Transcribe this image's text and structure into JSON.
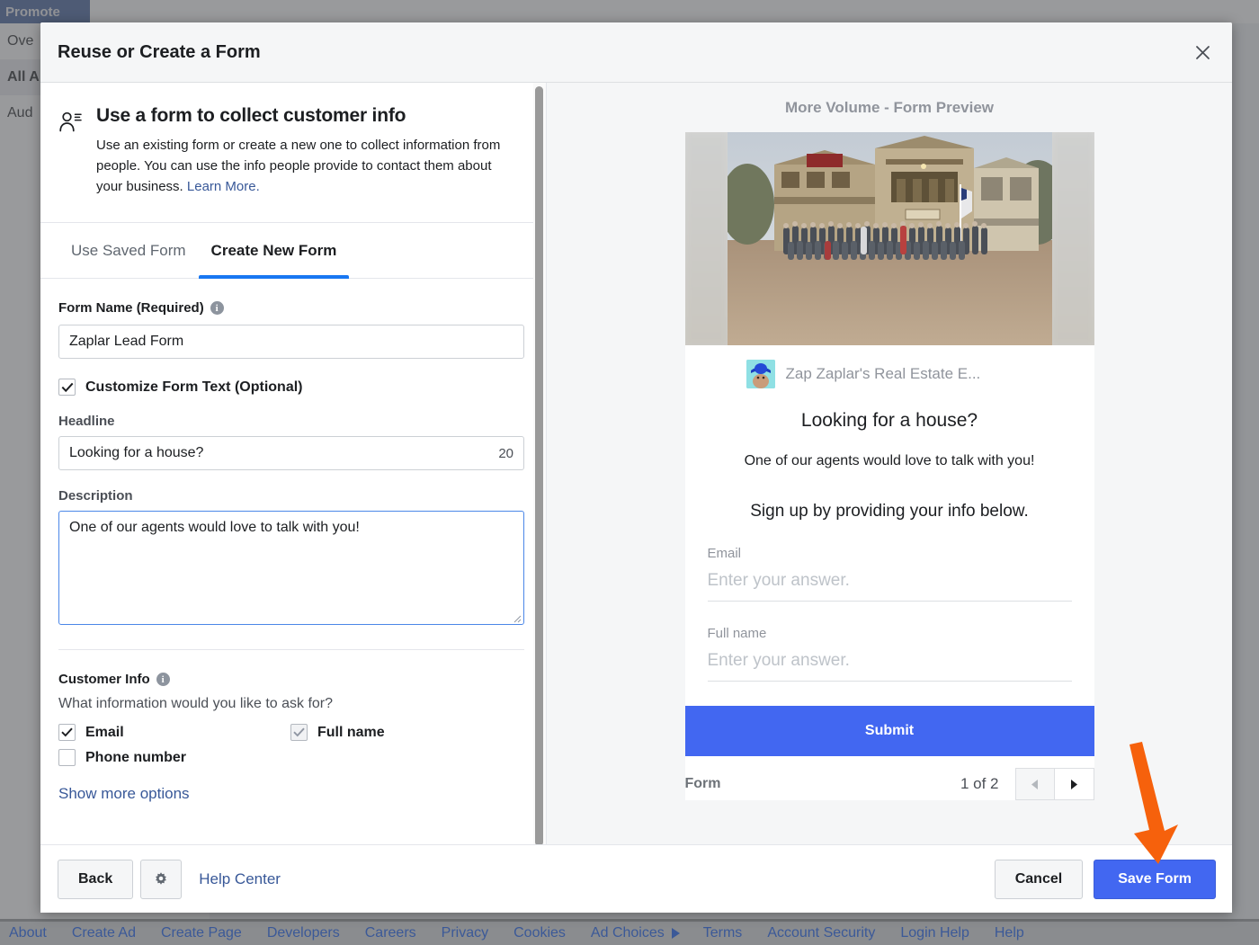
{
  "background": {
    "top_tab": "Promote",
    "nav_items": [
      {
        "label": "Ove",
        "selected": false
      },
      {
        "label": "All A",
        "selected": true
      },
      {
        "label": "Aud",
        "selected": false
      }
    ]
  },
  "footer_links": [
    "About",
    "Create Ad",
    "Create Page",
    "Developers",
    "Careers",
    "Privacy",
    "Cookies",
    "Ad Choices",
    "Terms",
    "Account Security",
    "Login Help",
    "Help"
  ],
  "modal": {
    "title": "Reuse or Create a Form",
    "close_icon": "close-icon",
    "intro": {
      "icon": "person-list-icon",
      "heading": "Use a form to collect customer info",
      "body": "Use an existing form or create a new one to collect information from people. You can use the info people provide to contact them about your business.",
      "link_label": "Learn More."
    },
    "tabs": [
      {
        "label": "Use Saved Form",
        "active": false
      },
      {
        "label": "Create New Form",
        "active": true
      }
    ],
    "form": {
      "form_name_label": "Form Name (Required)",
      "form_name_info_icon": "info-icon",
      "form_name_value": "Zaplar Lead Form",
      "customize_checkbox_label": "Customize Form Text (Optional)",
      "customize_checked": true,
      "headline_label": "Headline",
      "headline_value": "Looking for a house?",
      "headline_counter": "20",
      "description_label": "Description",
      "description_value": "One of our agents would love to talk with you!",
      "customer_info_label": "Customer Info",
      "customer_info_icon": "info-icon",
      "customer_info_question": "What information would you like to ask for?",
      "customer_info_options": [
        {
          "label": "Email",
          "checked": true,
          "disabled": false
        },
        {
          "label": "Full name",
          "checked": true,
          "disabled": true
        },
        {
          "label": "Phone number",
          "checked": false,
          "disabled": false
        }
      ],
      "show_more_label": "Show more options"
    },
    "preview": {
      "title": "More Volume - Form Preview",
      "hero_image_alt": "group-photo-western-town",
      "avatar_alt": "page-avatar",
      "business_name": "Zap Zaplar's Real Estate E...",
      "headline": "Looking for a house?",
      "description": "One of our agents would love to talk with you!",
      "signup_text": "Sign up by providing your info below.",
      "fields": [
        {
          "label": "Email",
          "placeholder": "Enter your answer."
        },
        {
          "label": "Full name",
          "placeholder": "Enter your answer."
        }
      ],
      "submit_label": "Submit",
      "pager_label": "Form",
      "pager_count": "1 of 2",
      "prev_icon": "chevron-left-icon",
      "next_icon": "chevron-right-icon"
    },
    "footer": {
      "back_label": "Back",
      "settings_icon": "gear-icon",
      "help_center_label": "Help Center",
      "cancel_label": "Cancel",
      "save_label": "Save Form"
    }
  },
  "annotation": {
    "arrow_icon": "down-arrow-annotation",
    "arrow_color": "#F6610C",
    "points_to": "Save Form"
  },
  "colors": {
    "primary_blue": "#4267f1",
    "tab_underline": "#1877f2",
    "link_blue": "#385898",
    "brand_navy": "#3b5998",
    "annotation_orange": "#F6610C"
  }
}
